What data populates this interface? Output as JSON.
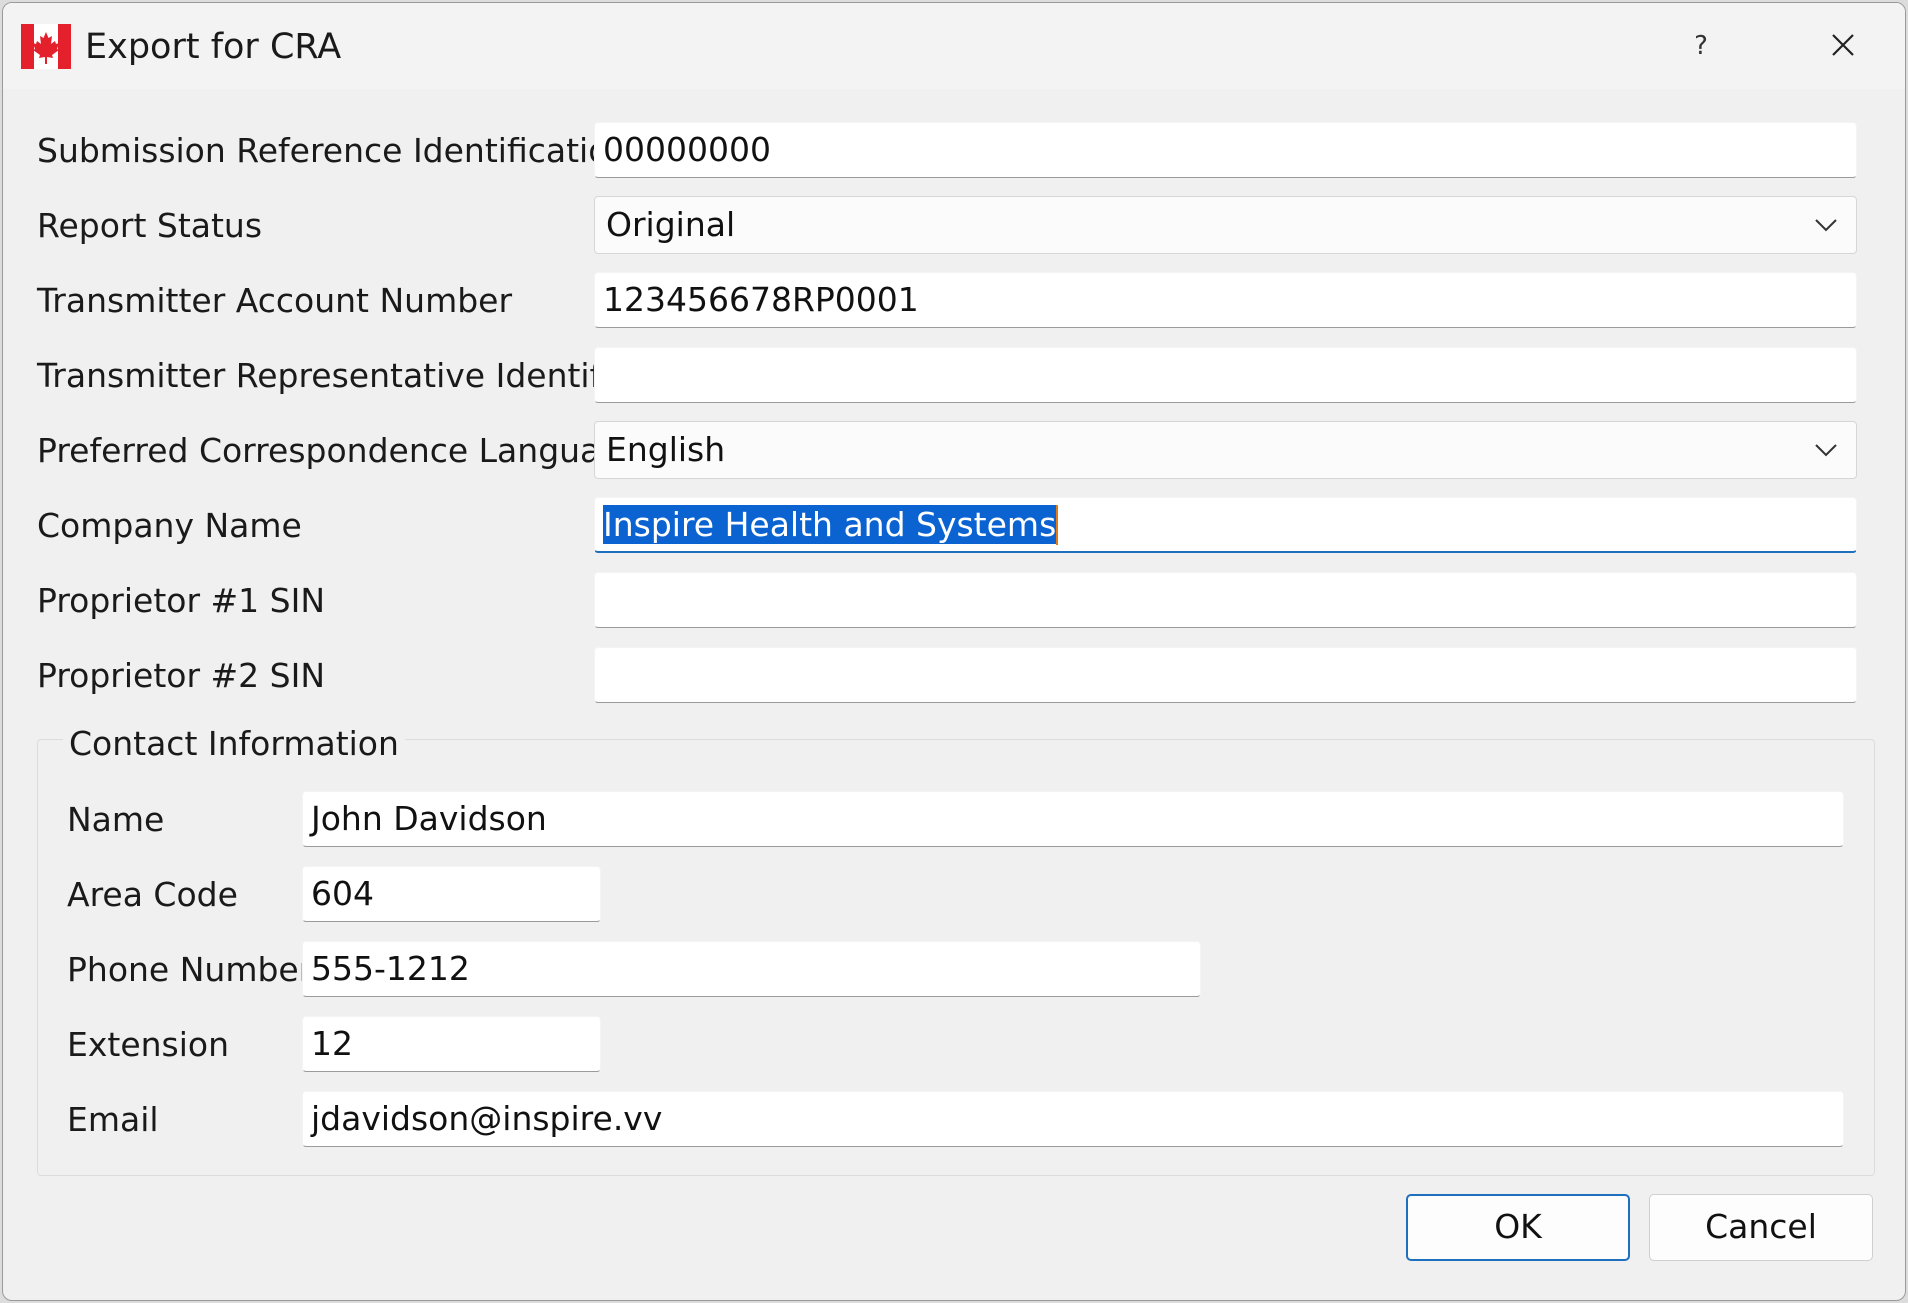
{
  "window": {
    "title": "Export for CRA",
    "help_label": "?",
    "flag_icon": "canada-flag-icon",
    "close_icon": "close-icon"
  },
  "form": {
    "submission_ref": {
      "label": "Submission Reference Identification",
      "value": "00000000"
    },
    "report_status": {
      "label": "Report Status",
      "value": "Original"
    },
    "transmitter_account": {
      "label": "Transmitter Account Number",
      "value": "123456678RP0001"
    },
    "transmitter_rep": {
      "label": "Transmitter Representative Identifier",
      "value": ""
    },
    "language": {
      "label": "Preferred Correspondence Language",
      "value": "English"
    },
    "company_name": {
      "label": "Company Name",
      "value": "Inspire Health and Systems"
    },
    "proprietor1": {
      "label": "Proprietor #1 SIN",
      "value": ""
    },
    "proprietor2": {
      "label": "Proprietor #2 SIN",
      "value": ""
    }
  },
  "contact": {
    "title": "Contact Information",
    "name": {
      "label": "Name",
      "value": "John Davidson"
    },
    "area_code": {
      "label": "Area Code",
      "value": "604"
    },
    "phone": {
      "label": "Phone Number",
      "value": "555-1212"
    },
    "extension": {
      "label": "Extension",
      "value": "12"
    },
    "email": {
      "label": "Email",
      "value": "jdavidson@inspire.vv"
    }
  },
  "buttons": {
    "ok": "OK",
    "cancel": "Cancel"
  },
  "colors": {
    "accent": "#1f6fbf",
    "selection": "#0b63d1",
    "flag_red": "#e3202b"
  }
}
